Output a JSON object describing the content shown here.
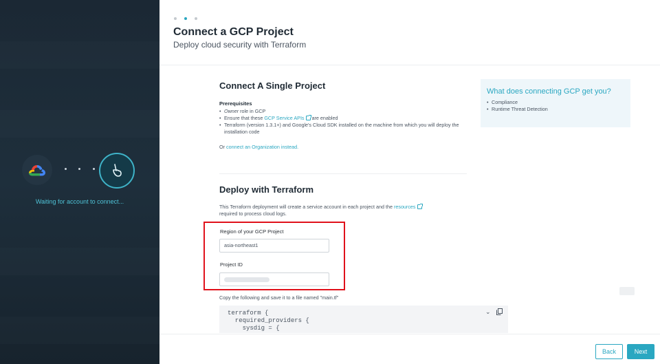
{
  "sidebar": {
    "waiting_text": "Waiting for account to connect...",
    "left_icon": "google-cloud-icon",
    "right_icon": "sysdig-shovel-icon"
  },
  "header": {
    "title": "Connect a GCP Project",
    "subtitle": "Deploy cloud security with Terraform"
  },
  "connect_section": {
    "title": "Connect A Single Project",
    "prereq_title": "Prerequisites",
    "prereq_owner_role": "Owner",
    "prereq_owner_suffix": " role in GCP",
    "prereq_apis_prefix": "Ensure that these ",
    "prereq_apis_link": "GCP Service APIs",
    "prereq_apis_suffix": " are enabled",
    "prereq_terraform": "Terraform (version 1.3.1+) and Google's Cloud SDK installed on the machine from which you will deploy the installation code",
    "or_prefix": "Or ",
    "or_link": "connect an Organization instead."
  },
  "deploy_section": {
    "title": "Deploy with Terraform",
    "desc_prefix": "This Terraform deployment will create a service account in each project and the ",
    "desc_link": "resources",
    "desc_suffix": "required to process cloud logs.",
    "region_label": "Region of your GCP Project",
    "region_value": "asia-northeast1",
    "project_label": "Project ID",
    "copy_hint": "Copy the following and save it to a file named \"main.tf\"",
    "code": "terraform {\n  required_providers {\n    sysdig = {"
  },
  "side_card": {
    "title": "What does connecting GCP get you?",
    "items": [
      "Compliance",
      "Runtime Threat Detection"
    ]
  },
  "footer": {
    "back_label": "Back",
    "next_label": "Next"
  },
  "theme": {
    "accent": "#2aa7c1",
    "highlight": "#e0101a",
    "sidebar_bg": "#1e2f3c"
  }
}
